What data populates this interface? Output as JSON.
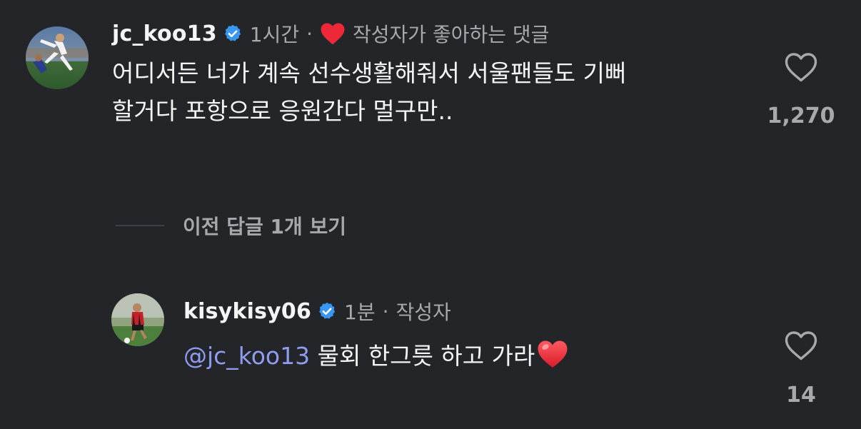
{
  "comment": {
    "username": "jc_koo13",
    "time": "1시간",
    "separator": "·",
    "liked_by_author": "작성자가 좋아하는 댓글",
    "text": "어디서든 너가 계속 선수생활해줘서 서울팬들도 기뻐\n할거다 포항으로 응원간다 멀구만..",
    "like_count": "1,270",
    "icons": {
      "verified": "verified-badge-icon",
      "liked": "red-heart-icon",
      "like": "heart-outline-icon"
    }
  },
  "view_replies": {
    "label": "이전 답글 1개 보기"
  },
  "reply": {
    "username": "kisykisy06",
    "time": "1분",
    "separator": "·",
    "author_tag": "작성자",
    "mention": "@jc_koo13",
    "text": " 물회 한그릇 하고 가라",
    "like_count": "14",
    "icons": {
      "verified": "verified-badge-icon",
      "emoji": "red-heart-emoji",
      "like": "heart-outline-icon"
    }
  },
  "colors": {
    "background": "#232529",
    "primary_text": "#f5f5f5",
    "secondary_text": "#a8a8ad",
    "mention": "#8f9cf0",
    "verified": "#3897f0",
    "heart": "#ed2939"
  }
}
